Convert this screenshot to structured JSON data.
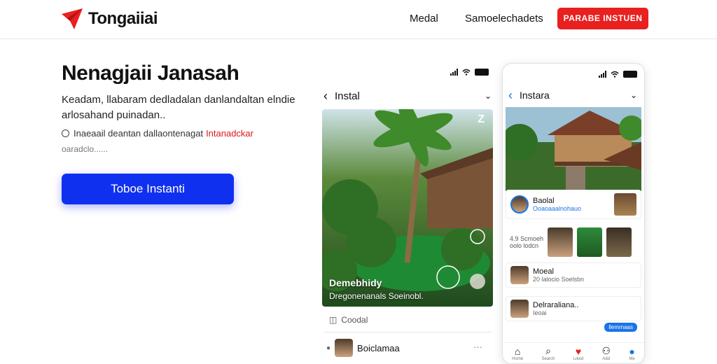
{
  "header": {
    "brand": "Tongaiiai",
    "nav": [
      "Medal",
      "Samoelechadets"
    ],
    "cta": "PARABE INSTUEN",
    "brand_color": "#e8201f"
  },
  "hero": {
    "title": "Nenagjaii Janasah",
    "description": "Keadam, llabaram dedladalan danlandaltan elndie arlosahand puinadan..",
    "note": "Inaeaail deantan dallaontenagat",
    "note_highlight": "Intanadckar",
    "note_sub": "oaradclo......",
    "button": "Toboe Instanti",
    "button_color": "#1030ef"
  },
  "phone1": {
    "title": "Instal",
    "photo_title": "Demebhidy",
    "photo_caption": "Dregonenanals Soeinobl.",
    "badge": "Z",
    "row_label": "Coodal",
    "user_name": "Boiclamaa",
    "more_icon": "ellipsis-icon"
  },
  "phone2": {
    "title": "Instara",
    "card1": {
      "name": "Baolal",
      "meta": "Ooaoaaalnohauo"
    },
    "stats": [
      "4.9 Scmoeh",
      "oolo lodcn"
    ],
    "card2": {
      "name": "Moeal",
      "meta": "20 lalocio Soelsbn"
    },
    "card3": {
      "name": "Delraraliana..",
      "meta": "Ieoai"
    },
    "pill": "llemrnaas",
    "tabs": [
      "home-icon",
      "search-icon",
      "heart-icon",
      "profile-add-icon",
      "profile-icon"
    ],
    "tab_labels": [
      "Home",
      "Search",
      "Liked",
      "Add",
      "Me"
    ]
  }
}
